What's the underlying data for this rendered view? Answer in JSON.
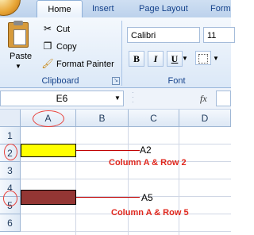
{
  "ribbon": {
    "tabs": [
      "Home",
      "Insert",
      "Page Layout",
      "Form"
    ],
    "clipboard": {
      "paste_label": "Paste",
      "cut_label": "Cut",
      "copy_label": "Copy",
      "format_painter_label": "Format Painter",
      "group_label": "Clipboard"
    },
    "font": {
      "font_name": "Calibri",
      "font_size": "11",
      "bold_label": "B",
      "italic_label": "I",
      "underline_label": "U",
      "group_label": "Font"
    }
  },
  "formula_bar": {
    "name_box": "E6",
    "fx_label": "fx",
    "formula": ""
  },
  "grid": {
    "columns": [
      "A",
      "B",
      "C",
      "D"
    ],
    "rows": [
      "1",
      "2",
      "3",
      "4",
      "5",
      "6"
    ],
    "highlight_colors": {
      "a2": "#ffff00",
      "a5": "#943634"
    }
  },
  "annotations": {
    "a2_callout": "A2",
    "a2_note": "Column A & Row 2",
    "a5_callout": "A5",
    "a5_note": "Column A & Row 5",
    "accent_color": "#e0281e"
  }
}
